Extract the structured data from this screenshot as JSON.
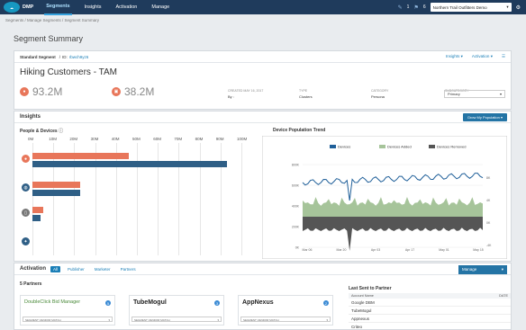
{
  "app": {
    "logo_text": "salesforce",
    "product": "DMP",
    "nav": [
      "Segments",
      "Insights",
      "Activation",
      "Manage"
    ],
    "nav_active": 0,
    "notifications_count": "1",
    "messages_count": "6",
    "org": "Northern Trail Outfitters Demo"
  },
  "breadcrumb": "Segments  /  Manage Segments  /  Segment Summary",
  "page_title": "Segment Summary",
  "summary": {
    "segment_type": "Standard Segment",
    "id_label": "ID:",
    "id_value": "rbwch9yz6",
    "insights_link": "Insights",
    "activation_link": "Activation",
    "name": "Hiking Customers - TAM",
    "metric_1": "93.2M",
    "metric_2": "38.2M",
    "meta": [
      {
        "label": "CREATED MAY 16, 2017",
        "value": "By :"
      },
      {
        "label": "TYPE",
        "value": "Clusters"
      },
      {
        "label": "CATEGORY",
        "value": "Persona"
      },
      {
        "label": "SUBCATEGORY",
        "value": "Primary"
      }
    ]
  },
  "insights": {
    "title": "Insights",
    "grow_button": "Grow My Population",
    "people_devices": "People & Devices",
    "x_ticks": [
      "0M",
      "10M",
      "20M",
      "30M",
      "40M",
      "50M",
      "60M",
      "70M",
      "80M",
      "90M",
      "100M"
    ],
    "trend_title": "Device Population Trend",
    "legend": [
      "Devices",
      "Devices Added",
      "Devices Removed"
    ]
  },
  "chart_data": [
    {
      "type": "bar",
      "title": "People & Devices",
      "xlim": [
        0,
        100
      ],
      "categories": [
        "People",
        "Cookies",
        "Mobile"
      ],
      "series": [
        {
          "name": "",
          "values": [
            46,
            23,
            5
          ]
        },
        {
          "name": "",
          "values": [
            93,
            23,
            4
          ]
        }
      ],
      "colors": [
        "#e8765a",
        "#2f5f86"
      ]
    },
    {
      "type": "area",
      "title": "Device Population Trend",
      "legend": [
        "Devices",
        "Devices Added",
        "Devices Removed"
      ],
      "left_axis_ticks": [
        "800K",
        "600K",
        "400K",
        "200K",
        "0K"
      ],
      "right_axis_ticks": [
        "8K",
        "4K",
        "0K",
        "-4K"
      ],
      "x_ticks": [
        "Mar 06",
        "Mar 13",
        "Mar 20",
        "Mar 27",
        "Apr 03",
        "Apr 10",
        "Apr 17",
        "Apr 24",
        "May 01",
        "May 08",
        "May 15"
      ],
      "colors": [
        "#1f5f99",
        "#a6c49a",
        "#555555"
      ]
    }
  ],
  "activation": {
    "title": "Activation",
    "tabs": [
      "All",
      "Publisher",
      "Marketer",
      "Partners"
    ],
    "manage_button": "Manage",
    "partners_count": "5 Partners",
    "partners": [
      {
        "name": "DoubleClick Bid Manager",
        "badge": "5",
        "match": "SEGMENT VENDOR MATCH"
      },
      {
        "name": "TubeMogul",
        "badge": "3",
        "match": "SEGMENT VENDOR MATCH"
      },
      {
        "name": "AppNexus",
        "badge": "2",
        "match": "SEGMENT VENDOR MATCH"
      }
    ],
    "last_sent_title": "Last Sent to Partner",
    "last_sent_header": [
      "Account Name",
      "DATE"
    ],
    "last_sent_rows": [
      "Google DBM",
      "TubeMogul",
      "Appnexus",
      "Criteo"
    ]
  }
}
